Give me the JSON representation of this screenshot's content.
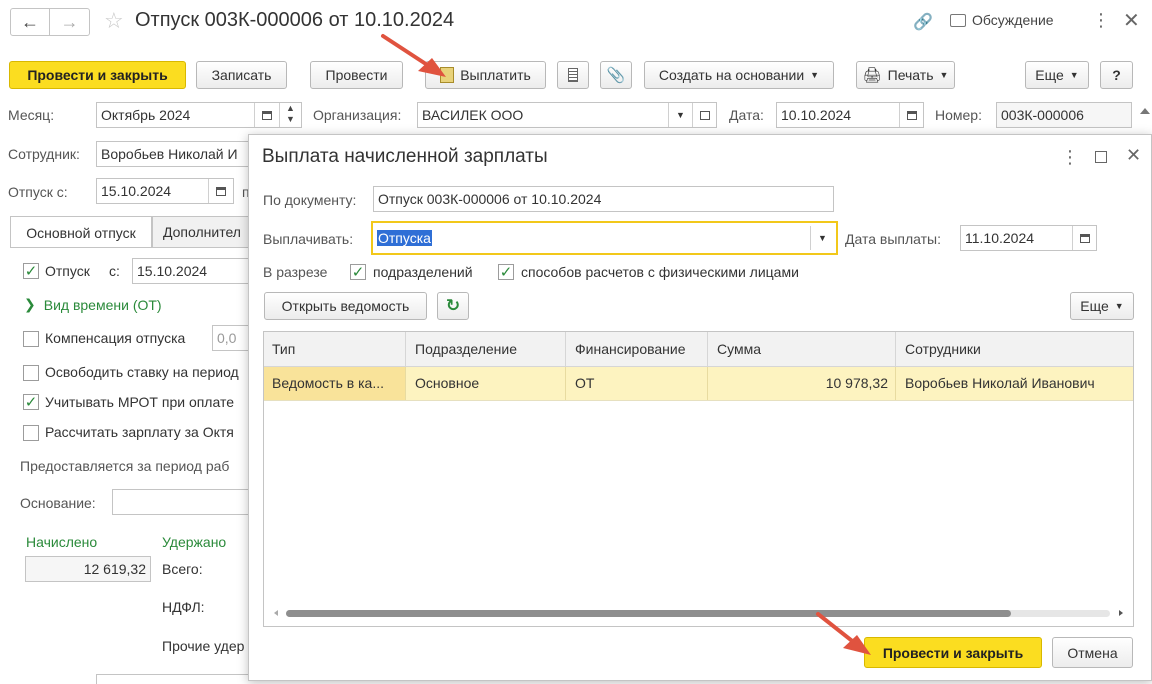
{
  "window": {
    "title": "Отпуск 003К-000006 от 10.10.2024",
    "discussion_label": "Обсуждение"
  },
  "toolbar": {
    "post_and_close": "Провести и закрыть",
    "write": "Записать",
    "post": "Провести",
    "pay": "Выплатить",
    "create_based_on": "Создать на основании",
    "print": "Печать",
    "more": "Еще",
    "help": "?"
  },
  "header": {
    "month_label": "Месяц:",
    "month_value": "Октябрь 2024",
    "org_label": "Организация:",
    "org_value": "ВАСИЛЕК ООО",
    "date_label": "Дата:",
    "date_value": "10.10.2024",
    "number_label": "Номер:",
    "number_value": "003К-000006",
    "employee_label": "Сотрудник:",
    "employee_value": "Воробьев Николай И",
    "vacation_from_label": "Отпуск с:",
    "vacation_from_value": "15.10.2024",
    "vacation_to_fragment": "п"
  },
  "tabs": [
    {
      "label": "Основной отпуск"
    },
    {
      "label": "Дополнител"
    }
  ],
  "main_tab": {
    "vacation_label": "Отпуск",
    "vacation_from_label": "с:",
    "vacation_from_value": "15.10.2024",
    "time_kind_label": "Вид времени (ОТ)",
    "compensation_label": "Компенсация отпуска",
    "compensation_value": "0,0",
    "free_rate_label": "Освободить ставку на период",
    "mrot_label": "Учитывать МРОТ при оплате",
    "calc_salary_label": "Рассчитать зарплату за Октя",
    "period_text": "Предоставляется за период раб",
    "basis_label": "Основание:",
    "accrued_label": "Начислено",
    "withheld_label": "Удержано",
    "accrued_value": "12 619,32",
    "total_label": "Всего:",
    "ndfl_label": "НДФЛ:",
    "other_label": "Прочие удер"
  },
  "dialog": {
    "title": "Выплата начисленной зарплаты",
    "doc_label": "По документу:",
    "doc_value": "Отпуск 003К-000006 от 10.10.2024",
    "pay_label": "Выплачивать:",
    "pay_value": "Отпуска",
    "pay_date_label": "Дата выплаты:",
    "pay_date_value": "11.10.2024",
    "breakdown_label": "В разрезе",
    "by_dept_label": "подразделений",
    "by_method_label": "способов расчетов с физическими лицами",
    "open_statement": "Открыть ведомость",
    "more": "Еще",
    "columns": [
      "Тип",
      "Подразделение",
      "Финансирование",
      "Сумма",
      "Сотрудники"
    ],
    "rows": [
      {
        "type": "Ведомость в ка...",
        "dept": "Основное",
        "funding": "ОТ",
        "amount": "10 978,32",
        "employees": "Воробьев Николай Иванович"
      }
    ],
    "post_and_close": "Провести и закрыть",
    "cancel": "Отмена"
  },
  "colors": {
    "primary": "#fbdd20",
    "row_highlight": "#fdf3c0",
    "arrow": "#e0533f",
    "link_green": "#2a8a3a"
  }
}
